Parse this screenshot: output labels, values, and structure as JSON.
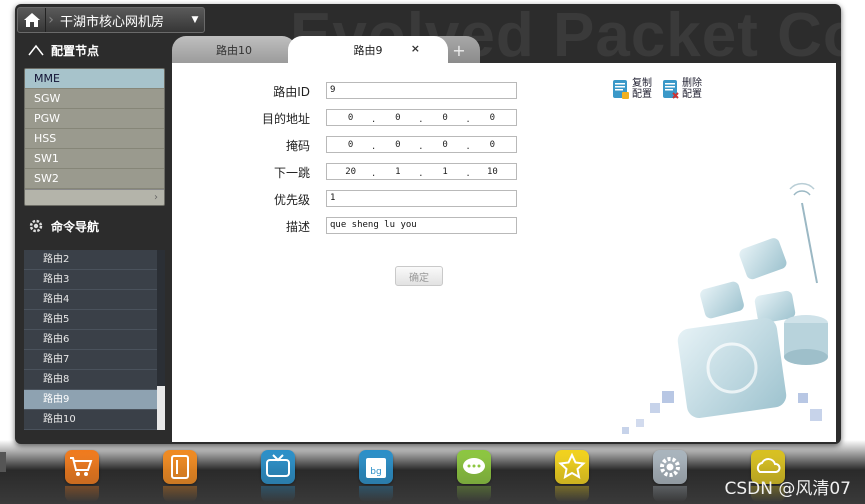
{
  "app": {
    "background_title": "Evolved Packet Core",
    "location_title": "干湖市核心网机房"
  },
  "sidebar": {
    "config_section_label": "配置节点",
    "config_items": [
      {
        "label": "MME",
        "active": true
      },
      {
        "label": "SGW",
        "active": false
      },
      {
        "label": "PGW",
        "active": false
      },
      {
        "label": "HSS",
        "active": false
      },
      {
        "label": "SW1",
        "active": false
      },
      {
        "label": "SW2",
        "active": false
      }
    ],
    "command_section_label": "命令导航",
    "command_items": [
      {
        "label": "路由2",
        "active": false
      },
      {
        "label": "路由3",
        "active": false
      },
      {
        "label": "路由4",
        "active": false
      },
      {
        "label": "路由5",
        "active": false
      },
      {
        "label": "路由6",
        "active": false
      },
      {
        "label": "路由7",
        "active": false
      },
      {
        "label": "路由8",
        "active": false
      },
      {
        "label": "路由9",
        "active": true
      },
      {
        "label": "路由10",
        "active": false
      }
    ]
  },
  "tabs": {
    "items": [
      "路由10",
      "路由9"
    ],
    "active_index": 1,
    "add_label": "+",
    "close_label": "×"
  },
  "form": {
    "route_id": {
      "label": "路由ID",
      "value": "9"
    },
    "destination": {
      "label": "目的地址",
      "octets": [
        "0",
        "0",
        "0",
        "0"
      ]
    },
    "mask": {
      "label": "掩码",
      "octets": [
        "0",
        "0",
        "0",
        "0"
      ]
    },
    "next_hop": {
      "label": "下一跳",
      "octets": [
        "20",
        "1",
        "1",
        "10"
      ]
    },
    "priority": {
      "label": "优先级",
      "value": "1"
    },
    "description": {
      "label": "描述",
      "value": "que sheng lu you"
    },
    "confirm_label": "确定"
  },
  "actions": {
    "copy_line1": "复制",
    "copy_line2": "配置",
    "delete_line1": "删除",
    "delete_line2": "配置"
  },
  "dock": {
    "icons": [
      {
        "name": "cart-icon",
        "color": "#f07a1c"
      },
      {
        "name": "notebook-icon",
        "color": "#f08a20"
      },
      {
        "name": "tv-icon",
        "color": "#2a8fc8"
      },
      {
        "name": "calendar-icon",
        "color": "#2a8fc8"
      },
      {
        "name": "chat-icon",
        "color": "#8cc63f"
      },
      {
        "name": "star-icon",
        "color": "#f2d21c"
      },
      {
        "name": "gear-icon",
        "color": "#a9b4bd"
      },
      {
        "name": "cloud-icon",
        "color": "#d8c020"
      }
    ]
  },
  "watermark": "CSDN @风清07"
}
